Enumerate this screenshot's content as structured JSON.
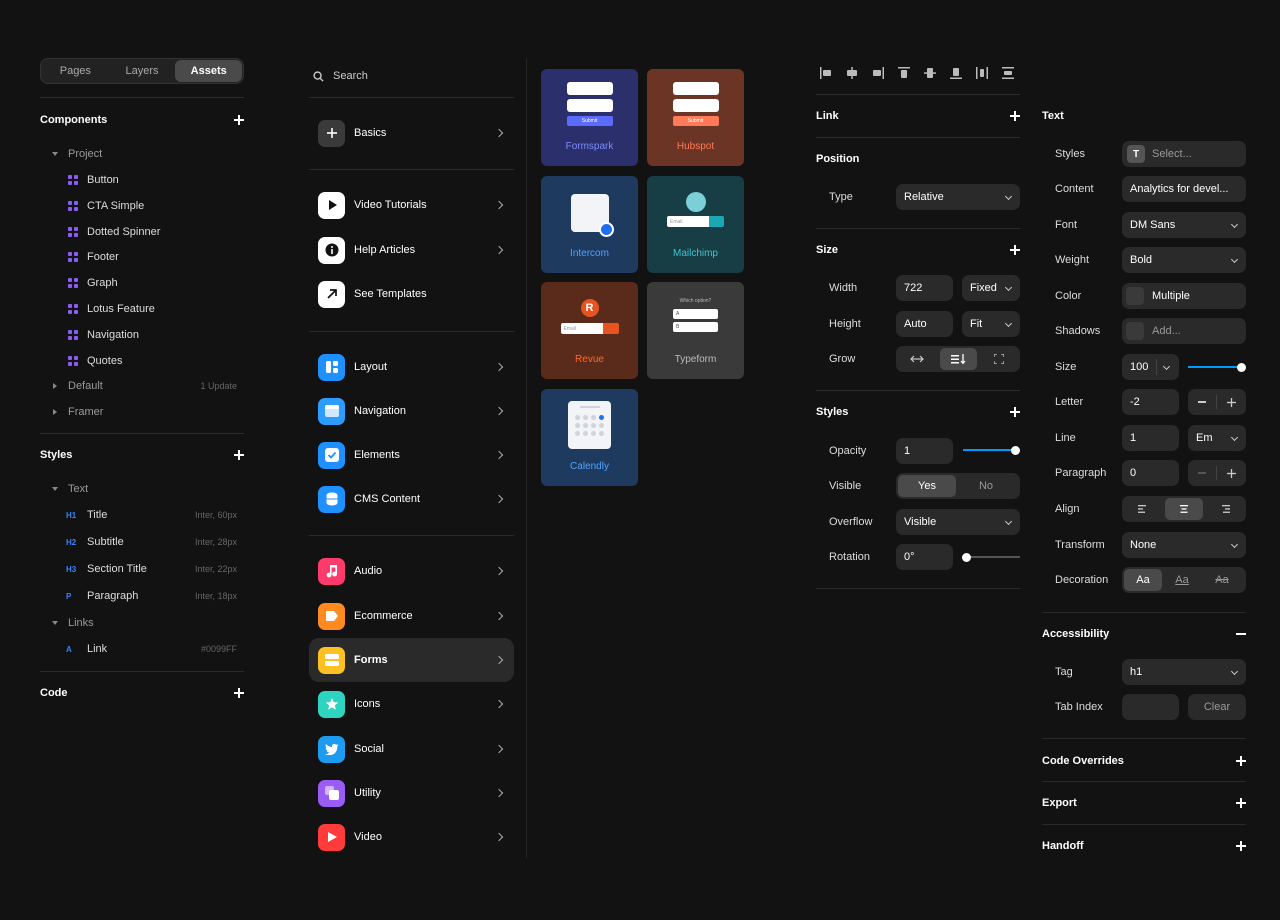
{
  "left_panel": {
    "tabs": [
      "Pages",
      "Layers",
      "Assets"
    ],
    "components": {
      "title": "Components",
      "project_label": "Project",
      "items": [
        "Button",
        "CTA Simple",
        "Dotted Spinner",
        "Footer",
        "Graph",
        "Lotus Feature",
        "Navigation",
        "Quotes"
      ],
      "default_label": "Default",
      "default_meta": "1 Update",
      "framer_label": "Framer"
    },
    "styles": {
      "title": "Styles",
      "text_label": "Text",
      "text_items": [
        {
          "tag": "H1",
          "name": "Title",
          "meta": "Inter, 60px"
        },
        {
          "tag": "H2",
          "name": "Subtitle",
          "meta": "Inter, 28px"
        },
        {
          "tag": "H3",
          "name": "Section Title",
          "meta": "Inter, 22px"
        },
        {
          "tag": "P",
          "name": "Paragraph",
          "meta": "Inter, 18px"
        }
      ],
      "links_label": "Links",
      "link_item": {
        "tag": "A",
        "name": "Link",
        "meta": "#0099FF"
      }
    },
    "code": {
      "title": "Code"
    }
  },
  "middle_panel": {
    "search_placeholder": "Search",
    "items": [
      {
        "label": "Basics",
        "icon": "plus-icon",
        "color": "#3a3a3a"
      },
      {
        "label": "Video Tutorials",
        "icon": "play-icon",
        "color": "#ffffff"
      },
      {
        "label": "Help Articles",
        "icon": "info-icon",
        "color": "#ffffff"
      },
      {
        "label": "See Templates",
        "icon": "arrow-up-right-icon",
        "color": "#ffffff"
      },
      {
        "label": "Layout",
        "icon": "layout-icon",
        "color": "#1e90ff"
      },
      {
        "label": "Navigation",
        "icon": "navigation-icon",
        "color": "#2d9cff"
      },
      {
        "label": "Elements",
        "icon": "checkbox-icon",
        "color": "#1e90ff"
      },
      {
        "label": "CMS Content",
        "icon": "database-icon",
        "color": "#1e90ff"
      },
      {
        "label": "Audio",
        "icon": "music-icon",
        "color": "#ff3b6b"
      },
      {
        "label": "Ecommerce",
        "icon": "tag-icon",
        "color": "#ff8a1f"
      },
      {
        "label": "Forms",
        "icon": "form-icon",
        "color": "#ffc021"
      },
      {
        "label": "Icons",
        "icon": "star-icon",
        "color": "#2dd4bf"
      },
      {
        "label": "Social",
        "icon": "twitter-icon",
        "color": "#1d9bf0"
      },
      {
        "label": "Utility",
        "icon": "utility-icon",
        "color": "#9b5cf6"
      },
      {
        "label": "Video",
        "icon": "video-icon",
        "color": "#ff3b3b"
      }
    ]
  },
  "forms_grid": {
    "cards": [
      {
        "label": "Formspark",
        "bg": "#2b2f6b",
        "label_color": "#7b8cff",
        "button": "Submit"
      },
      {
        "label": "Hubspot",
        "bg": "#6b3525",
        "label_color": "#ff7a59",
        "button": "Submit"
      },
      {
        "label": "Intercom",
        "bg": "#1f3a5f",
        "label_color": "#4da3ff"
      },
      {
        "label": "Mailchimp",
        "bg": "#173e44",
        "label_color": "#3fc3cf",
        "input": "Email"
      },
      {
        "label": "Revue",
        "bg": "#5a2a1a",
        "label_color": "#ff6a2a",
        "input": "Email"
      },
      {
        "label": "Typeform",
        "bg": "#3a3a3a",
        "label_color": "#bbbbbb",
        "question": "Which option?",
        "options": [
          "A",
          "B"
        ]
      },
      {
        "label": "Calendly",
        "bg": "#1f3a5f",
        "label_color": "#4da3ff"
      }
    ]
  },
  "layout_panel": {
    "link": {
      "title": "Link"
    },
    "position": {
      "title": "Position",
      "type_label": "Type",
      "type_value": "Relative"
    },
    "size": {
      "title": "Size",
      "width_label": "Width",
      "width_value": "722",
      "width_mode": "Fixed",
      "height_label": "Height",
      "height_value": "Auto",
      "height_mode": "Fit",
      "grow_label": "Grow"
    },
    "styles": {
      "title": "Styles",
      "opacity_label": "Opacity",
      "opacity_value": "1",
      "opacity_fraction": 1.0,
      "visible_label": "Visible",
      "visible_yes": "Yes",
      "visible_no": "No",
      "overflow_label": "Overflow",
      "overflow_value": "Visible",
      "rotation_label": "Rotation",
      "rotation_value": "0°",
      "rotation_fraction": 0.0
    }
  },
  "text_panel": {
    "title": "Text",
    "styles_label": "Styles",
    "styles_value": "Select...",
    "content_label": "Content",
    "content_value": "Analytics for devel...",
    "font_label": "Font",
    "font_value": "DM Sans",
    "weight_label": "Weight",
    "weight_value": "Bold",
    "color_label": "Color",
    "color_value": "Multiple",
    "shadows_label": "Shadows",
    "shadows_value": "Add...",
    "size_label": "Size",
    "size_value": "100",
    "size_fraction": 1.0,
    "letter_label": "Letter",
    "letter_value": "-2",
    "line_label": "Line",
    "line_value": "1",
    "line_unit": "Em",
    "paragraph_label": "Paragraph",
    "paragraph_value": "0",
    "align_label": "Align",
    "transform_label": "Transform",
    "transform_value": "None",
    "decoration_label": "Decoration",
    "decoration_options": [
      "Aa",
      "Aa",
      "Aa"
    ],
    "accessibility": {
      "title": "Accessibility",
      "tag_label": "Tag",
      "tag_value": "h1",
      "tabindex_label": "Tab Index",
      "clear_label": "Clear"
    },
    "code_overrides": "Code Overrides",
    "export": "Export",
    "handoff": "Handoff"
  },
  "colors": {
    "accent": "#0099ff",
    "panel_bg": "#121212",
    "field_bg": "#2a2a2a"
  }
}
